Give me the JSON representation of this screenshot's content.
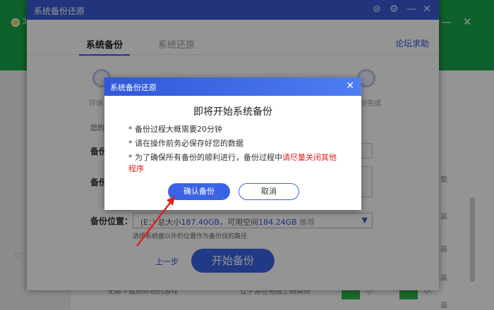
{
  "background_app": {
    "logo_text": "3€",
    "side_labels": [
      "载",
      "装",
      "装",
      "装",
      "装"
    ],
    "bottom_left_text": "无聊下载新好玩的游戏",
    "bottom_mid_text": "让手游在电脑上畅爽玩",
    "bottom_small": [
      "小",
      "小"
    ]
  },
  "main_window": {
    "title": "系统备份还原",
    "tabs": [
      {
        "label": "系统备份",
        "active": true
      },
      {
        "label": "系统还原",
        "active": false
      }
    ],
    "forum_link": "论坛求助",
    "step_labels": [
      "环境",
      "份完成"
    ],
    "form": {
      "small_label": "您的",
      "backup_name_label": "备份",
      "backup_desc_label": "备份",
      "location_label": "备份位置：",
      "location_value_prefix": "(E：)",
      "total_size_label": "总大小",
      "total_size": "187.40GB",
      "free_space_label": "可用空间",
      "free_space": "184.24GB",
      "recommend": "推荐",
      "location_hint": "选择系统盘以外的位置作为备份目的路径"
    },
    "prev_step": "上一步",
    "start_button": "开始备份"
  },
  "confirm_dialog": {
    "title": "系统备份还原",
    "heading": "即将开始系统备份",
    "bullets": [
      {
        "text": "* 备份过程大概需要20分钟",
        "warn": ""
      },
      {
        "text": "* 请在操作前务必保存好您的数据",
        "warn": ""
      },
      {
        "text": "* 为了确保所有备份的顺利进行，备份过程中",
        "warn": "请尽量关闭其他程序"
      }
    ],
    "confirm_button": "确认备份",
    "cancel_button": "取消"
  },
  "colors": {
    "accent_blue": "#3b64e5",
    "warning_red": "#e02020",
    "background_green": "#1aa84a"
  }
}
